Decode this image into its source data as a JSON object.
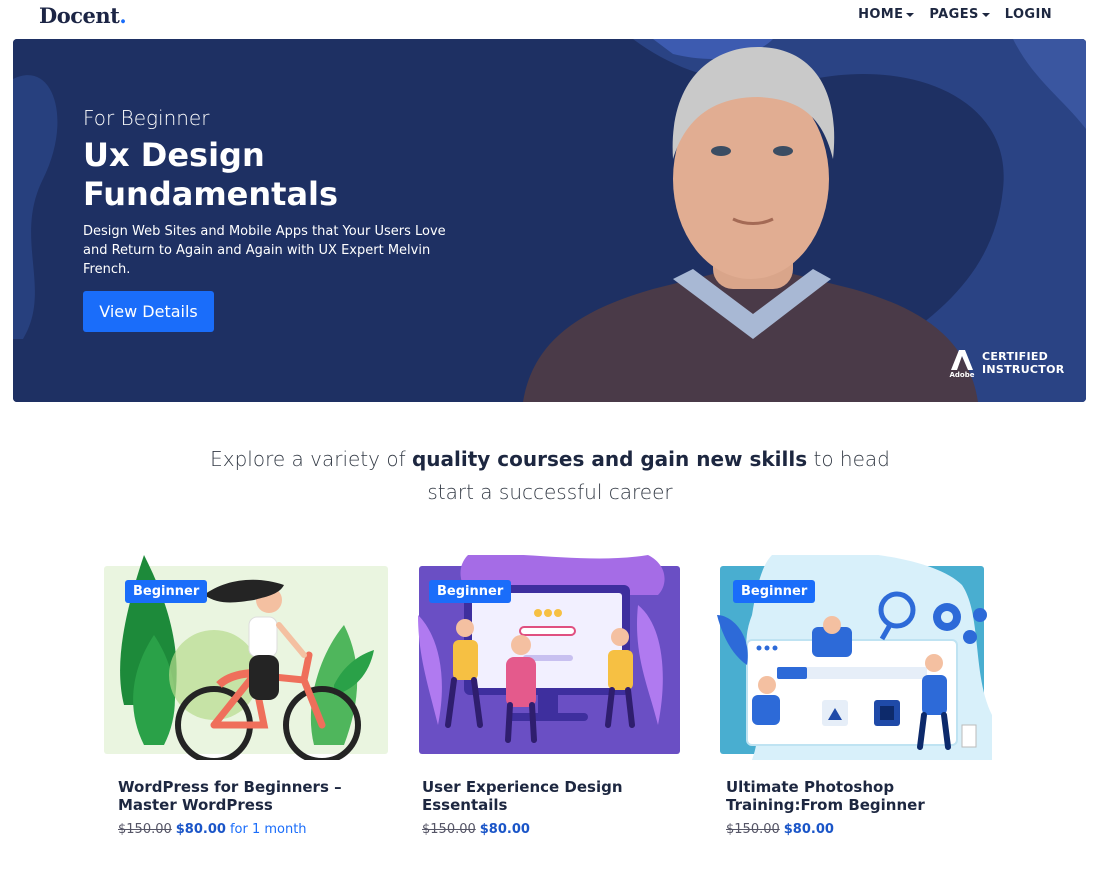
{
  "header": {
    "logo": "Docent",
    "logo_dot": ".",
    "nav": {
      "home": "HOME",
      "pages": "PAGES",
      "login": "LOGIN"
    }
  },
  "hero": {
    "subtitle": "For Beginner",
    "title": "Ux Design Fundamentals",
    "description": "Design Web Sites and Mobile Apps that Your Users Love and Return to Again and Again with UX Expert Melvin French.",
    "button": "View Details",
    "cert_logo_caption": "Adobe",
    "cert_line1": "CERTIFIED",
    "cert_line2": "INSTRUCTOR"
  },
  "tagline": {
    "part1": "Explore a variety of ",
    "bold": "quality courses and gain new skills",
    "part2": " to head start a successful career"
  },
  "courses": [
    {
      "badge": "Beginner",
      "title": "WordPress for Beginners – Master WordPress",
      "old_price": "$150.00",
      "price": "$80.00",
      "period": "for 1 month"
    },
    {
      "badge": "Beginner",
      "title": "User Experience Design Essentails",
      "old_price": "$150.00",
      "price": "$80.00"
    },
    {
      "badge": "Beginner",
      "title": "Ultimate Photoshop Training:From Beginner",
      "old_price": "$150.00",
      "price": "$80.00"
    }
  ],
  "colors": {
    "brand": "#1a6dfa",
    "hero_bg": "#1e3063",
    "heading": "#1d2740",
    "price": "#1a55c8"
  }
}
